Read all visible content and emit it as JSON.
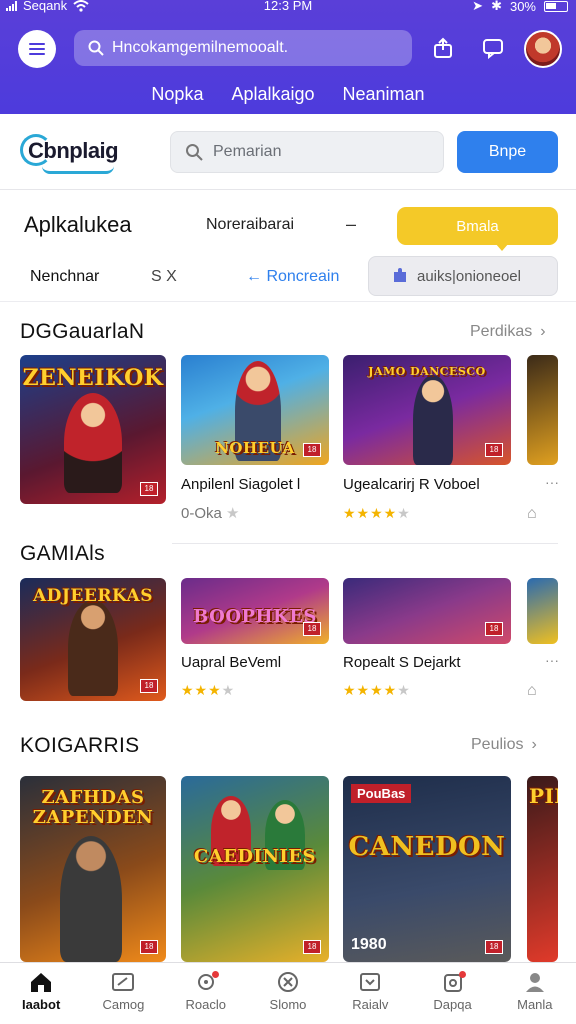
{
  "status_bar": {
    "carrier": "Seqank",
    "time": "12:3 PM",
    "battery": "30%"
  },
  "header": {
    "search_text": "Hncokamgemilnemooalt.",
    "tabs": [
      "Nopka",
      "Aplalkaigo",
      "Neaniman"
    ]
  },
  "brand": {
    "logo_text": "Cbnplaig",
    "search_placeholder": "Pemarian",
    "button_label": "Bnpe"
  },
  "filters": {
    "title": "Aplkalukea",
    "sort_label": "Noreraibarai",
    "dash": "–",
    "yellow_button": "Bmala",
    "chip_1": "Nenchnar",
    "chip_2": "S X",
    "link": "Roncreain",
    "pill_label": "auiks|onioneoel"
  },
  "sections": [
    {
      "title": "DGGauarlaN",
      "link": "Perdikas",
      "items": [
        {
          "art_text": "ZENEIKOK",
          "title": "",
          "meta": "",
          "colors": [
            "#1c3f8a",
            "#b4202b"
          ]
        },
        {
          "art_text": "NOHEUA",
          "title": "Anpilenl Siagolet l",
          "meta": "0-Oka",
          "rating": 1,
          "max": 1,
          "colors": [
            "#2a7fd0",
            "#f0a51e"
          ]
        },
        {
          "art_text": "JAMO DANCESCO",
          "title": "Ugealcarirj R Voboel",
          "meta": "",
          "rating": 4,
          "max": 5,
          "colors": [
            "#3a1f6e",
            "#d8552a"
          ]
        },
        {
          "art_text": "",
          "title": "",
          "meta": "",
          "colors": [
            "#3b2a18",
            "#e0a020"
          ]
        }
      ]
    },
    {
      "title": "GAMIAls",
      "link": "",
      "items": [
        {
          "art_text": "ADJEERKAS",
          "title": "",
          "meta": "",
          "colors": [
            "#1a2b5a",
            "#e05a1c"
          ]
        },
        {
          "art_text": "BOOPHKES",
          "title": "Uapral BeVeml",
          "meta": "",
          "rating": 3,
          "max": 4,
          "colors": [
            "#6a2c8a",
            "#f0b02a"
          ]
        },
        {
          "art_text": "",
          "title": "Ropealt S Dejarkt",
          "meta": "",
          "rating": 4,
          "max": 5,
          "colors": [
            "#3a2a7a",
            "#d04a6a"
          ]
        },
        {
          "art_text": "",
          "title": "",
          "meta": "",
          "colors": [
            "#2a6ab0",
            "#f0c020"
          ]
        }
      ]
    },
    {
      "title": "KOIGARRIS",
      "link": "Peulios",
      "items": [
        {
          "art_text": "ZAFHDAS ZAPENDEN",
          "title": "",
          "meta": "",
          "colors": [
            "#2a2f3a",
            "#f08a1a"
          ]
        },
        {
          "art_text": "CAEDINIES",
          "title": "",
          "meta": "",
          "colors": [
            "#2a6a9a",
            "#e8b02a"
          ]
        },
        {
          "art_text": "CANEDON",
          "title": "",
          "meta": "",
          "top_text": "PouBas",
          "bottom_text": "1980",
          "colors": [
            "#1e2d4a",
            "#f0c020"
          ]
        },
        {
          "art_text": "PIM",
          "title": "",
          "meta": "",
          "colors": [
            "#3a1a1a",
            "#e03a2a"
          ]
        }
      ]
    }
  ],
  "bottom_nav": [
    {
      "label": "Iaabot",
      "icon": "home-icon",
      "active": true
    },
    {
      "label": "Camog",
      "icon": "gamepad-icon"
    },
    {
      "label": "Roaclo",
      "icon": "controller-icon",
      "dot": true
    },
    {
      "label": "Slomo",
      "icon": "compass-icon"
    },
    {
      "label": "Raialv",
      "icon": "download-icon"
    },
    {
      "label": "Dapqa",
      "icon": "bag-icon",
      "dot": true
    },
    {
      "label": "Manla",
      "icon": "profile-icon"
    }
  ]
}
